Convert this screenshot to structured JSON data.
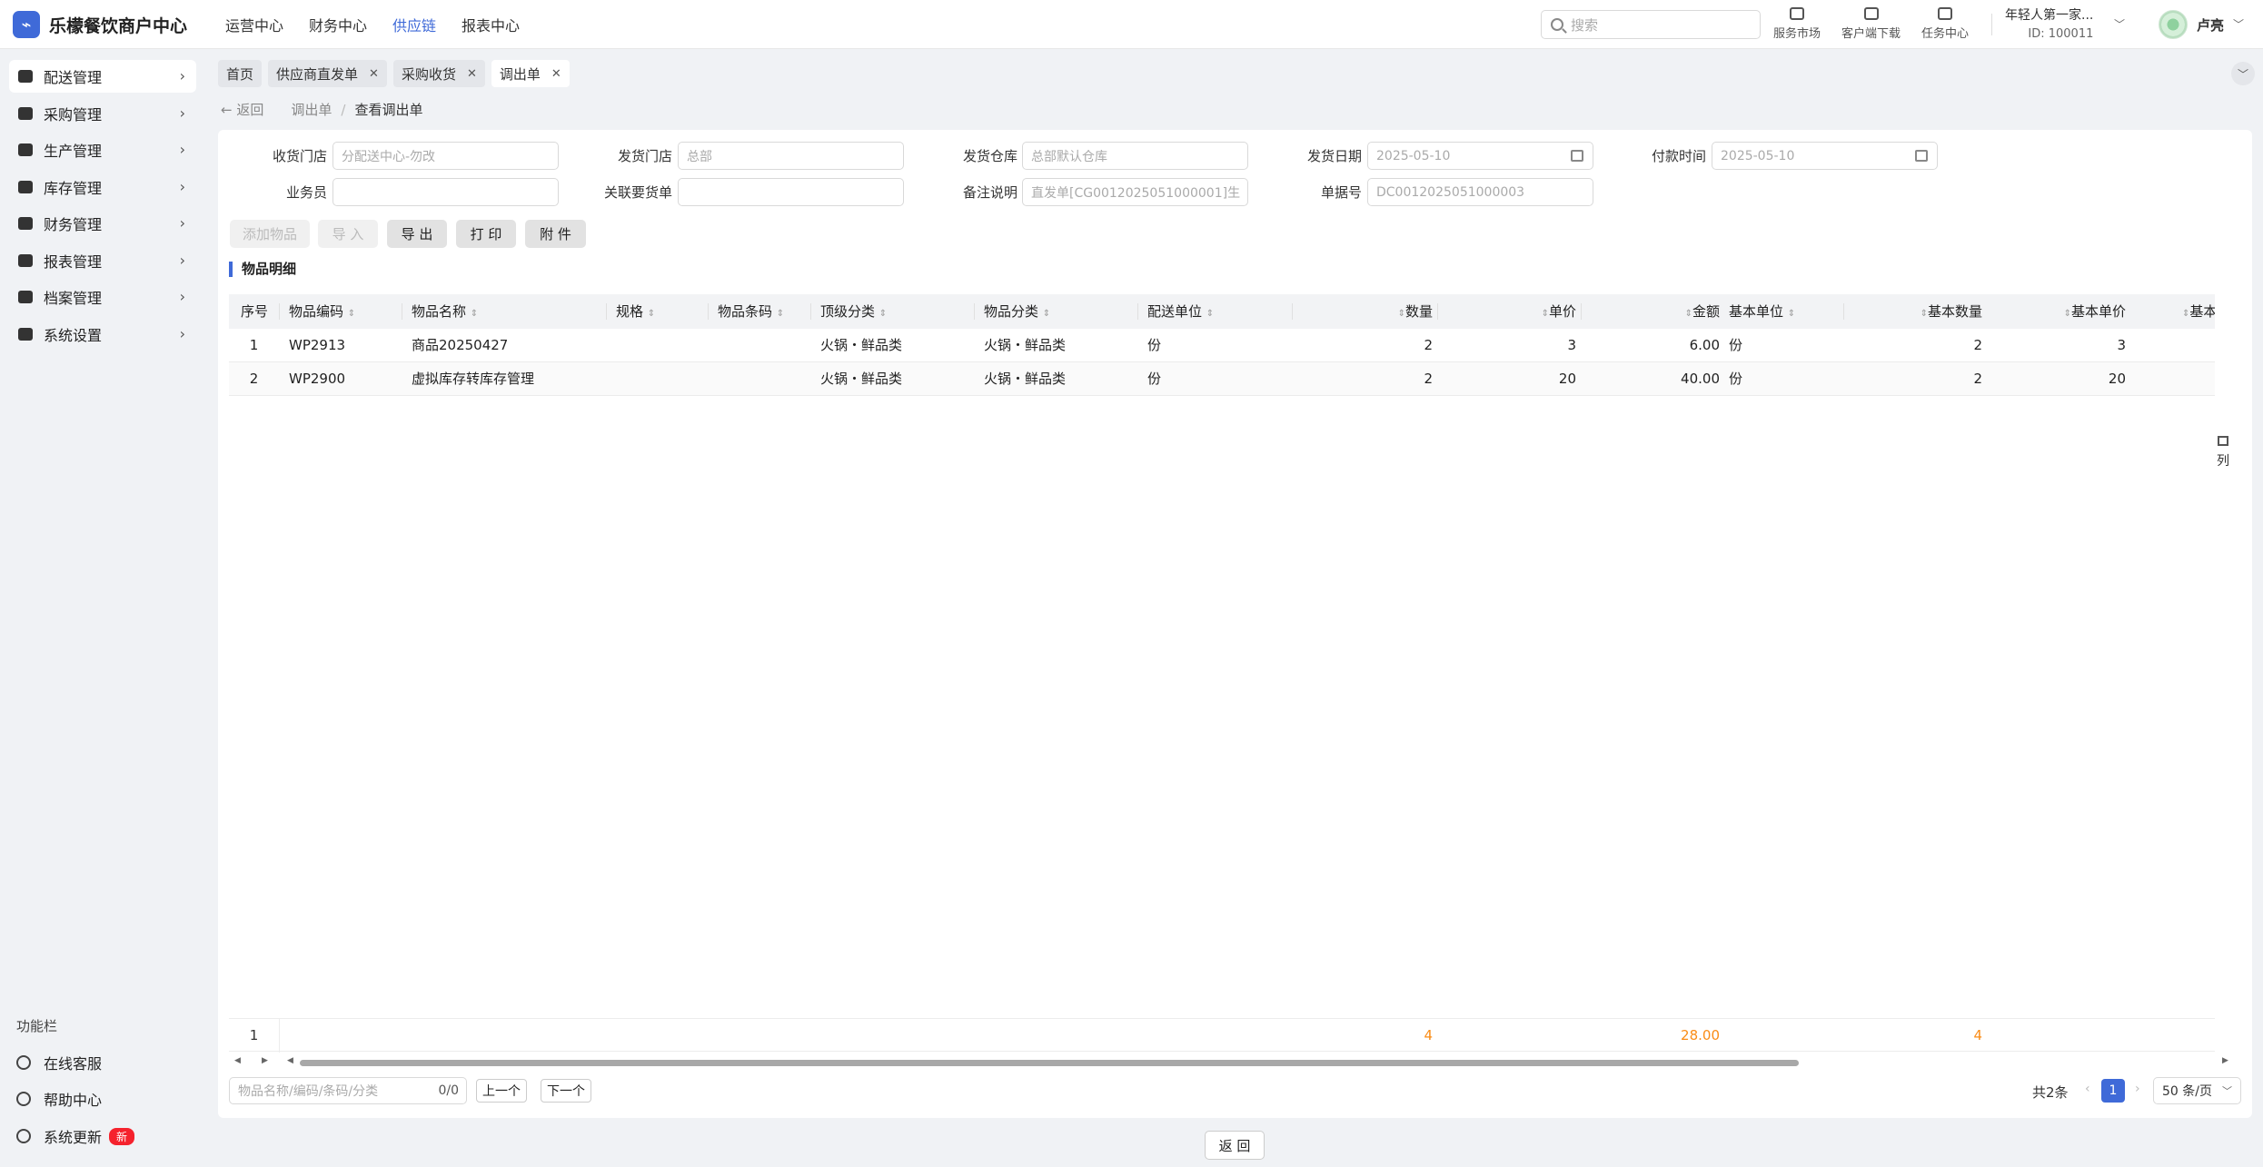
{
  "app": {
    "logo_char": "⌁",
    "title": "乐檬餐饮商户中心"
  },
  "top_nav": [
    "运营中心",
    "财务中心",
    "供应链",
    "报表中心"
  ],
  "search": {
    "placeholder": "搜索"
  },
  "tools": {
    "market": "服务市场",
    "download": "客户端下载",
    "tasks": "任务中心"
  },
  "account": {
    "name": "年轻人第一家...",
    "id": "ID: 100011",
    "user": "卢亮"
  },
  "sidebar": {
    "items": [
      "配送管理",
      "采购管理",
      "生产管理",
      "库存管理",
      "财务管理",
      "报表管理",
      "档案管理",
      "系统设置"
    ],
    "section_label": "功能栏",
    "functions": [
      "在线客服",
      "帮助中心",
      "系统更新"
    ],
    "new_badge": "新"
  },
  "tabs": [
    "首页",
    "供应商直发单",
    "采购收货",
    "调出单"
  ],
  "breadcrumb": {
    "back": "返回",
    "parent": "调出单",
    "current": "查看调出单"
  },
  "form": {
    "receive_store_label": "收货门店",
    "receive_store_value": "分配送中心-勿改",
    "send_store_label": "发货门店",
    "send_store_value": "总部",
    "warehouse_label": "发货仓库",
    "warehouse_value": "总部默认仓库",
    "ship_date_label": "发货日期",
    "ship_date_value": "2025-05-10",
    "pay_time_label": "付款时间",
    "pay_time_value": "2025-05-10",
    "salesman_label": "业务员",
    "salesman_value": "",
    "related_order_label": "关联要货单",
    "related_order_value": "",
    "remark_label": "备注说明",
    "remark_value": "直发单[CG0012025051000001]生",
    "doc_no_label": "单据号",
    "doc_no_value": "DC0012025051000003"
  },
  "actions": {
    "add_item": "添加物品",
    "import": "导 入",
    "export": "导 出",
    "print": "打 印",
    "attach": "附 件"
  },
  "section_title": "物品明细",
  "table": {
    "columns": [
      "序号",
      "物品编码",
      "物品名称",
      "规格",
      "物品条码",
      "顶级分类",
      "物品分类",
      "配送单位",
      "数量",
      "单价",
      "金额",
      "基本单位",
      "基本数量",
      "基本单价",
      "基本"
    ],
    "rows": [
      [
        "1",
        "WP2913",
        "商品20250427",
        "",
        "",
        "火锅・鲜品类",
        "火锅・鲜品类",
        "份",
        "2",
        "3",
        "6.00",
        "份",
        "2",
        "3"
      ],
      [
        "2",
        "WP2900",
        "虚拟库存转库存管理",
        "",
        "",
        "火锅・鲜品类",
        "火锅・鲜品类",
        "份",
        "2",
        "20",
        "40.00",
        "份",
        "2",
        "20"
      ]
    ],
    "summary": {
      "count": "1",
      "qty": "4",
      "amount": "28.00",
      "base_qty": "4"
    },
    "column_settings": "列"
  },
  "footer": {
    "find_placeholder": "物品名称/编码/条码/分类",
    "find_count": "0/0",
    "prev": "上一个",
    "next": "下一个",
    "total": "共2条",
    "current_page": "1",
    "page_size": "50 条/页"
  },
  "bottom": {
    "return": "返 回"
  },
  "colors": {
    "accent": "#3f6ad8",
    "summary": "#fa8c16",
    "badge": "#f5222d"
  }
}
